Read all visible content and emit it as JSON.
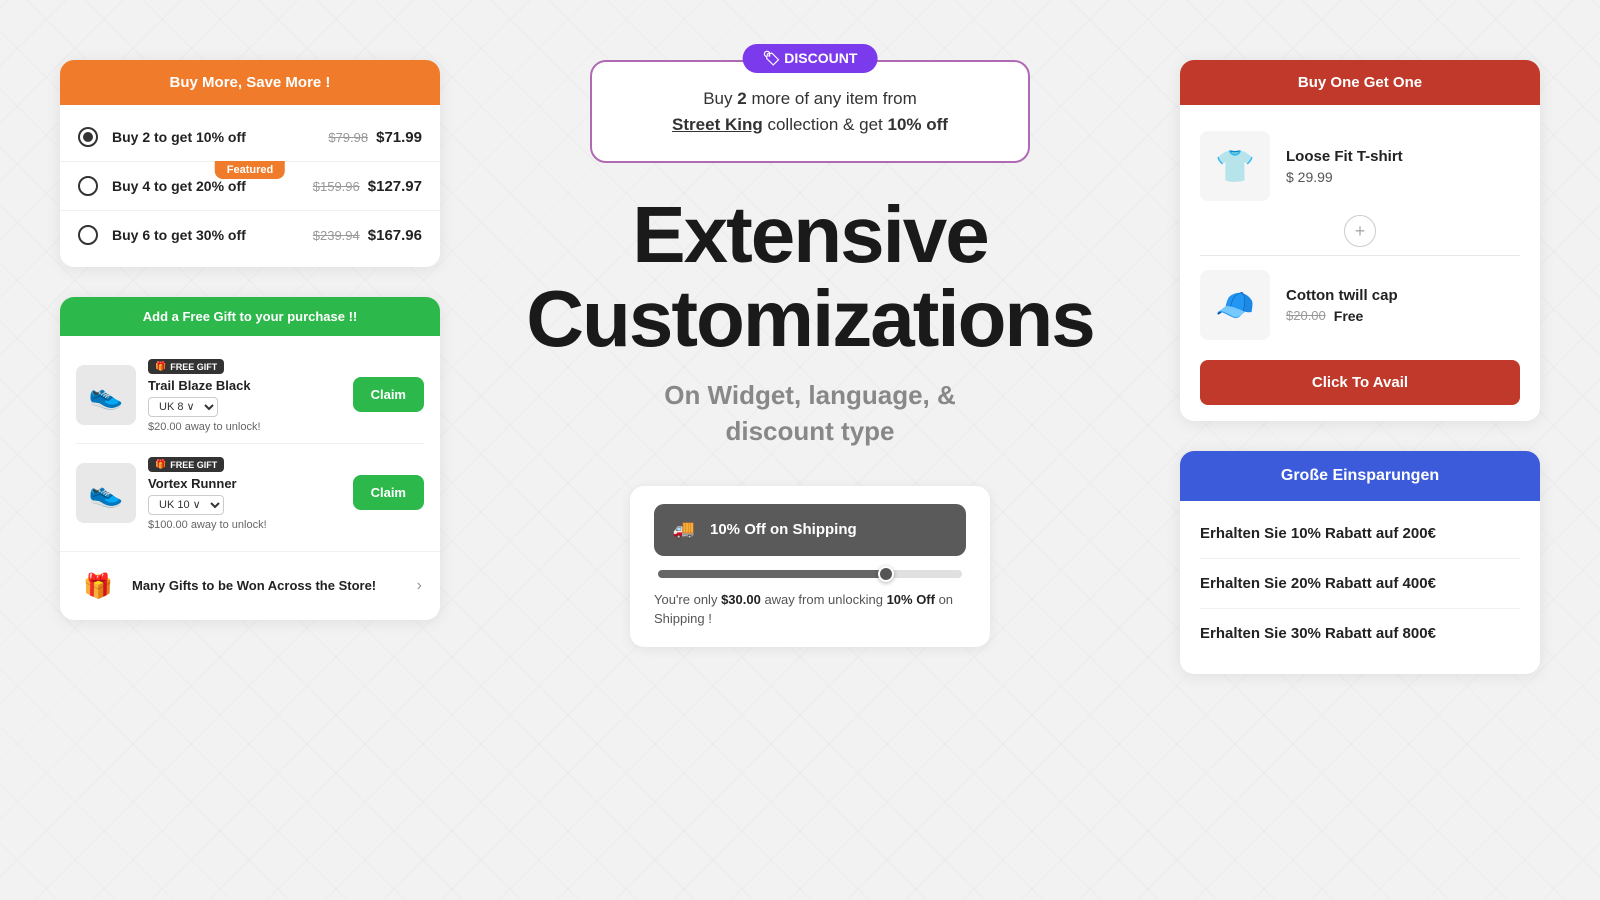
{
  "left": {
    "buy_more": {
      "header": "Buy More, Save More !",
      "options": [
        {
          "label": "Buy 2 to get 10% off",
          "original": "$79.98",
          "sale": "$71.99",
          "selected": true,
          "featured": false
        },
        {
          "label": "Buy 4 to get 20% off",
          "original": "$159.96",
          "sale": "$127.97",
          "selected": false,
          "featured": true
        },
        {
          "label": "Buy 6 to get 30% off",
          "original": "$239.94",
          "sale": "$167.96",
          "selected": false,
          "featured": false
        }
      ],
      "featured_label": "Featured"
    },
    "free_gift": {
      "header": "Add a Free Gift to your purchase !!",
      "items": [
        {
          "name": "Trail Blaze Black",
          "badge": "FREE GIFT",
          "size": "UK 8",
          "unlock_text": "$20.00 away to unlock!",
          "emoji": "👟"
        },
        {
          "name": "Vortex Runner",
          "badge": "FREE GIFT",
          "size": "UK 10",
          "unlock_text": "$100.00 away to unlock!",
          "emoji": "👟"
        }
      ],
      "claim_label": "Claim",
      "many_gifts_text": "Many Gifts to be Won\nAcross the Store!"
    }
  },
  "center": {
    "discount": {
      "badge": "🏷 DISCOUNT",
      "text_before": "Buy ",
      "text_bold1": "2",
      "text_mid": " more of any item from",
      "text_brand": "Street King",
      "text_after": " collection & get ",
      "text_highlight": "10% off"
    },
    "heading": {
      "title_line1": "Extensive",
      "title_line2": "Customizations",
      "subtitle": "On Widget, language, &\ndiscount type"
    },
    "shipping": {
      "header": "10% Off on Shipping",
      "progress": 75,
      "desc_before": "You're only ",
      "amount": "$30.00",
      "desc_mid": " away from unlocking ",
      "highlight": "10% Off",
      "desc_after": " on Shipping !"
    }
  },
  "right": {
    "bogo": {
      "header": "Buy One Get One",
      "product1": {
        "name": "Loose Fit T-shirt",
        "price": "$ 29.99",
        "emoji": "👕"
      },
      "product2": {
        "name": "Cotton twill cap",
        "original_price": "$20.00",
        "price": "Free",
        "emoji": "🧢"
      },
      "cta": "Click To Avail"
    },
    "savings": {
      "header": "Große Einsparungen",
      "items": [
        "Erhalten Sie 10% Rabatt auf 200€",
        "Erhalten Sie 20% Rabatt auf 400€",
        "Erhalten Sie 30% Rabatt auf 800€"
      ]
    }
  },
  "icons": {
    "radio_checked": "●",
    "radio_unchecked": "○",
    "truck": "🚚",
    "gift": "🎁",
    "chevron_right": "›",
    "plus": "+"
  }
}
